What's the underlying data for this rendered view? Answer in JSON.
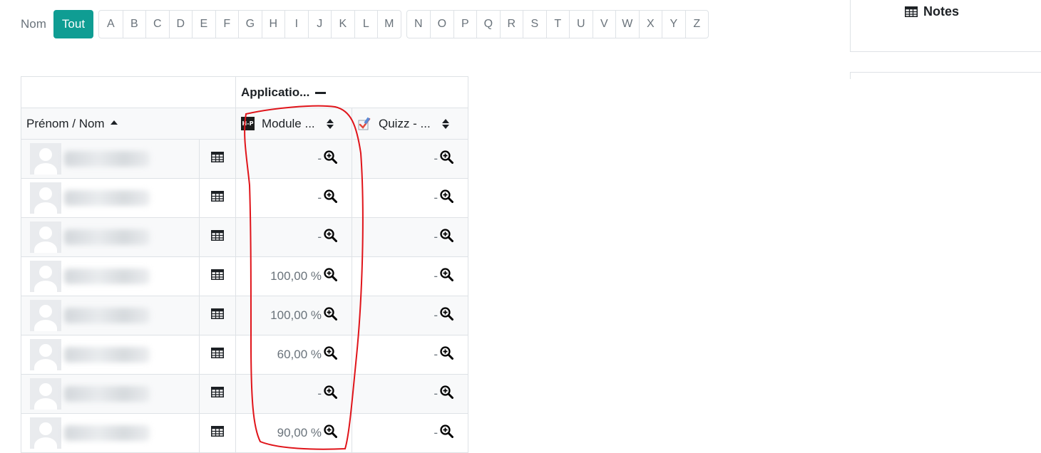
{
  "initials_bar": {
    "label": "Nom",
    "all_label": "Tout",
    "group1": [
      "A",
      "B",
      "C",
      "D",
      "E",
      "F",
      "G",
      "H",
      "I",
      "J",
      "K",
      "L",
      "M"
    ],
    "group2": [
      "N",
      "O",
      "P",
      "Q",
      "R",
      "S",
      "T",
      "U",
      "V",
      "W",
      "X",
      "Y",
      "Z"
    ]
  },
  "side_block": {
    "title": "Notes",
    "icon": "table-icon"
  },
  "table": {
    "category_label": "Applicatio...",
    "name_header": "Prénom / Nom",
    "columns": [
      {
        "label": "Module ...",
        "icon": "h5p-icon",
        "icon_text": "H-P"
      },
      {
        "label": "Quizz - ...",
        "icon": "quiz-icon"
      }
    ],
    "rows": [
      {
        "grades": [
          "-",
          "-"
        ]
      },
      {
        "grades": [
          "-",
          "-"
        ]
      },
      {
        "grades": [
          "-",
          "-"
        ]
      },
      {
        "grades": [
          "100,00 %",
          "-"
        ]
      },
      {
        "grades": [
          "100,00 %",
          "-"
        ]
      },
      {
        "grades": [
          "60,00 %",
          "-"
        ]
      },
      {
        "grades": [
          "-",
          "-"
        ]
      },
      {
        "grades": [
          "90,00 %",
          "-"
        ]
      }
    ]
  },
  "colors": {
    "accent": "#0f9d93",
    "annotation": "#e0141a"
  }
}
